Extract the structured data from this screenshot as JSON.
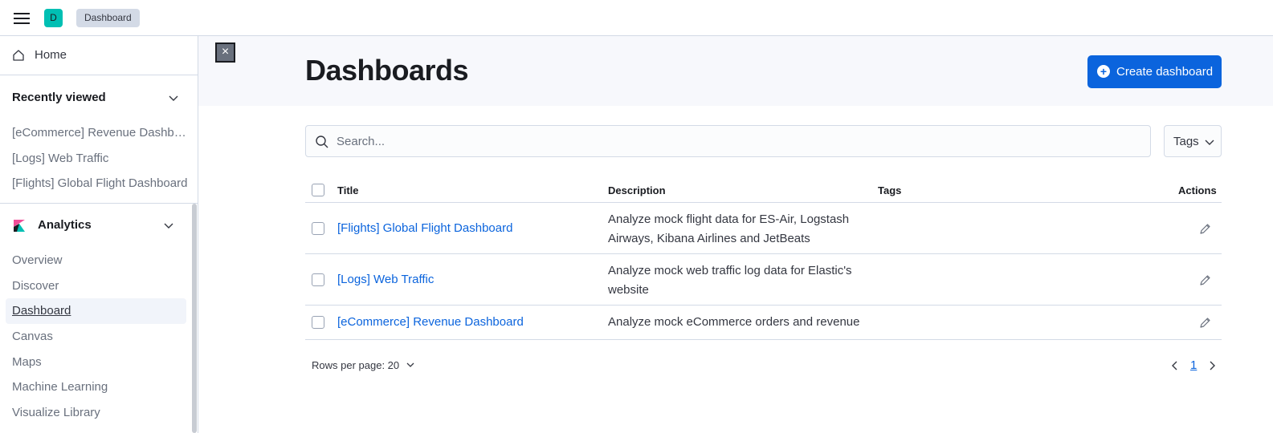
{
  "topbar": {
    "avatar_letter": "D",
    "breadcrumb": "Dashboard"
  },
  "sidebar": {
    "home_label": "Home",
    "recently_viewed": {
      "heading": "Recently viewed",
      "items": [
        "[eCommerce] Revenue Dashboard",
        "[Logs] Web Traffic",
        "[Flights] Global Flight Dashboard"
      ]
    },
    "analytics": {
      "heading": "Analytics",
      "items": [
        {
          "label": "Overview"
        },
        {
          "label": "Discover"
        },
        {
          "label": "Dashboard",
          "active": true
        },
        {
          "label": "Canvas"
        },
        {
          "label": "Maps"
        },
        {
          "label": "Machine Learning"
        },
        {
          "label": "Visualize Library"
        }
      ]
    }
  },
  "main": {
    "title": "Dashboards",
    "create_button": "Create dashboard",
    "search_placeholder": "Search...",
    "tags_filter": "Tags",
    "table": {
      "columns": [
        "Title",
        "Description",
        "Tags",
        "Actions"
      ],
      "rows": [
        {
          "title": "[Flights] Global Flight Dashboard",
          "description": "Analyze mock flight data for ES-Air, Logstash Airways, Kibana Airlines and JetBeats"
        },
        {
          "title": "[Logs] Web Traffic",
          "description": "Analyze mock web traffic log data for Elastic's website"
        },
        {
          "title": "[eCommerce] Revenue Dashboard",
          "description": "Analyze mock eCommerce orders and revenue"
        }
      ]
    },
    "pagination": {
      "rows_per_page": "Rows per page: 20",
      "current_page": "1"
    }
  },
  "colors": {
    "accent": "#0b64dd",
    "avatar_bg": "#00bfb3",
    "header_bg": "#f7f8fc"
  }
}
